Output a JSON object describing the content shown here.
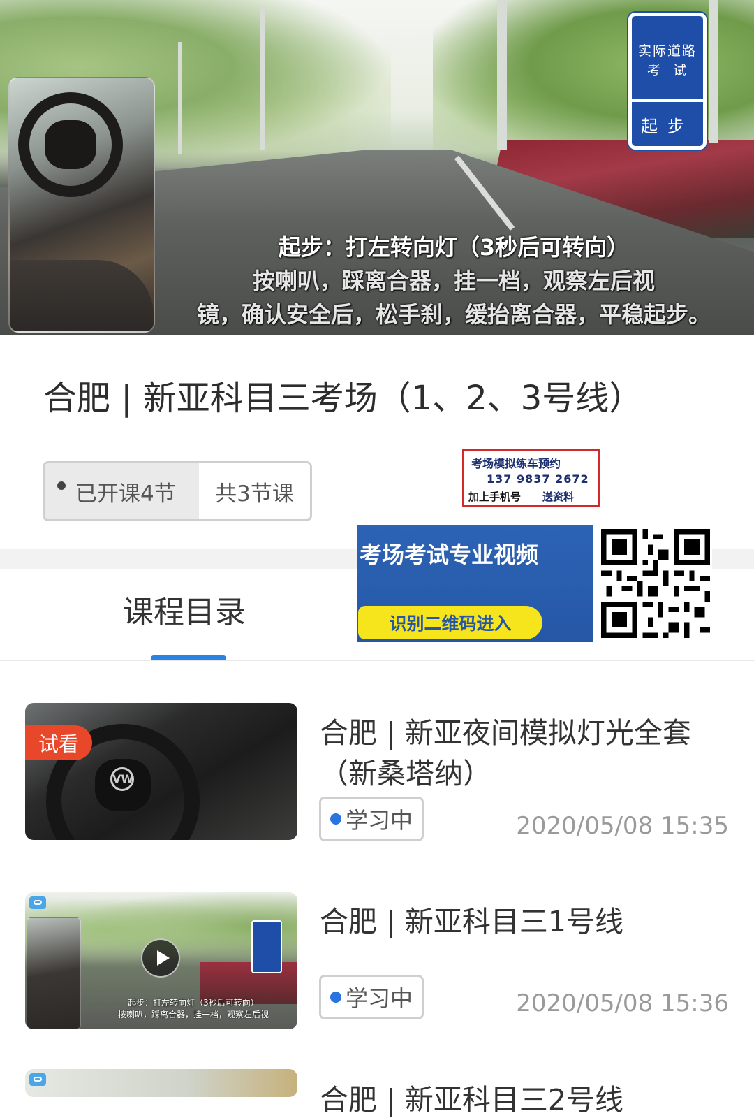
{
  "hero": {
    "caption_line1": "起步：打左转向灯（3秒后可转向）",
    "caption_line2": "按喇叭，踩离合器，挂一档，观察左后视",
    "caption_line3": "镜，确认安全后，松手刹，缓抬离合器，平稳起步。",
    "sign_top": "实际道路\n考 试",
    "sign_bottom": "起步"
  },
  "course": {
    "title": "合肥 | 新亚科目三考场（1、2、3号线）",
    "opened_lessons": "已开课4节",
    "total_lessons": "共3节课"
  },
  "promo": {
    "line1": "考场模拟练车预约",
    "phone": "137 9837 2672",
    "line3": "加上手机号",
    "line4": "送资料"
  },
  "banner": {
    "headline": "考场考试专业视频",
    "scan_button": "识别二维码进入"
  },
  "tabs": {
    "catalog": "课程目录"
  },
  "lessons": [
    {
      "title": "合肥 | 新亚夜间模拟灯光全套（新桑塔纳）",
      "badge": "试看",
      "status": "学习中",
      "time": "2020/05/08 15:35",
      "logo": "VW"
    },
    {
      "title": "合肥 | 新亚科目三1号线",
      "status": "学习中",
      "time": "2020/05/08 15:36",
      "caption_line1": "起步：打左转向灯（3秒后可转向）",
      "caption_line2": "按喇叭，踩离合器，挂一档，观察左后视"
    },
    {
      "title": "合肥 | 新亚科目三2号线"
    }
  ],
  "colors": {
    "accent": "#2a82e4",
    "status_dot": "#2a74e0",
    "trial_badge": "#e8472a",
    "promo_border": "#d22a2a",
    "banner_blue": "#2557a6",
    "banner_button": "#f6e51d"
  }
}
